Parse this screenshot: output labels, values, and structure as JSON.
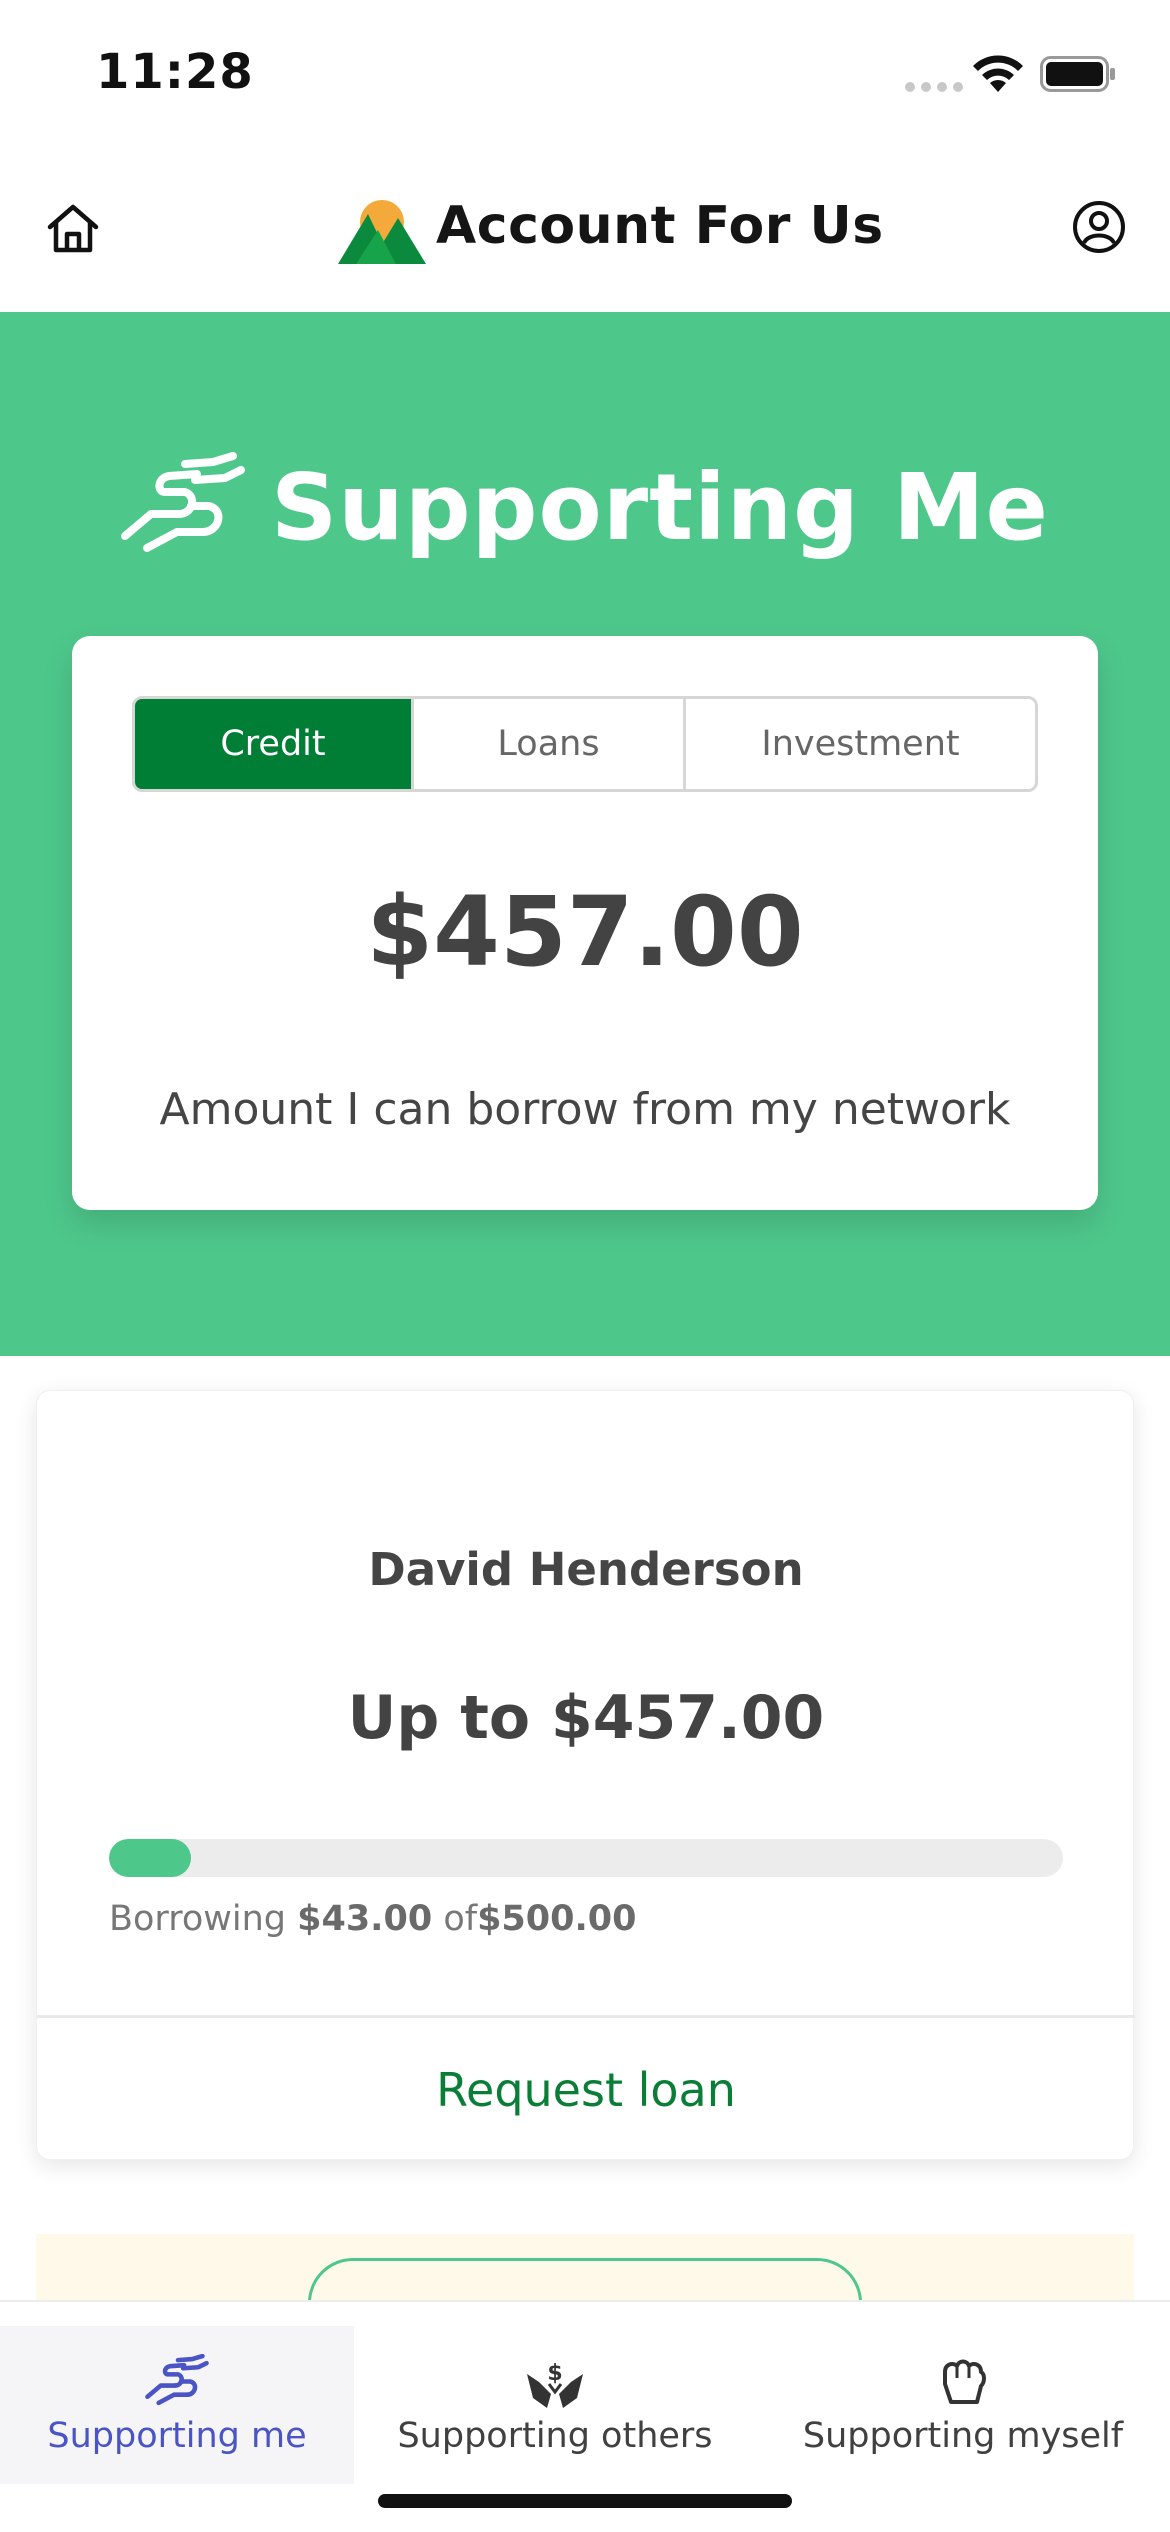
{
  "status_bar": {
    "time": "11:28"
  },
  "header": {
    "app_name": "Account For Us"
  },
  "hero": {
    "title": "Supporting Me",
    "tabs": [
      {
        "label": "Credit",
        "active": true
      },
      {
        "label": "Loans",
        "active": false
      },
      {
        "label": "Investment",
        "active": false
      }
    ],
    "amount": "$457.00",
    "caption": "Amount I can borrow from my network"
  },
  "lender_card": {
    "name": "David Henderson",
    "limit": "Up to $457.00",
    "progress_fraction": 0.086,
    "borrow_prefix": "Borrowing",
    "borrowed": "$43.00",
    "borrow_middle": "of",
    "total": "$500.00",
    "request_label": "Request loan"
  },
  "tab_bar": {
    "items": [
      {
        "label": "Supporting me",
        "icon": "handshake-icon",
        "active": true
      },
      {
        "label": "Supporting others",
        "icon": "giving-hands-icon",
        "active": false
      },
      {
        "label": "Supporting myself",
        "icon": "fist-icon",
        "active": false
      }
    ]
  },
  "colors": {
    "hero_green": "#4ec78b",
    "active_tab": "#007e35",
    "link_green": "#0a7d37",
    "active_nav": "#4a54c4"
  }
}
